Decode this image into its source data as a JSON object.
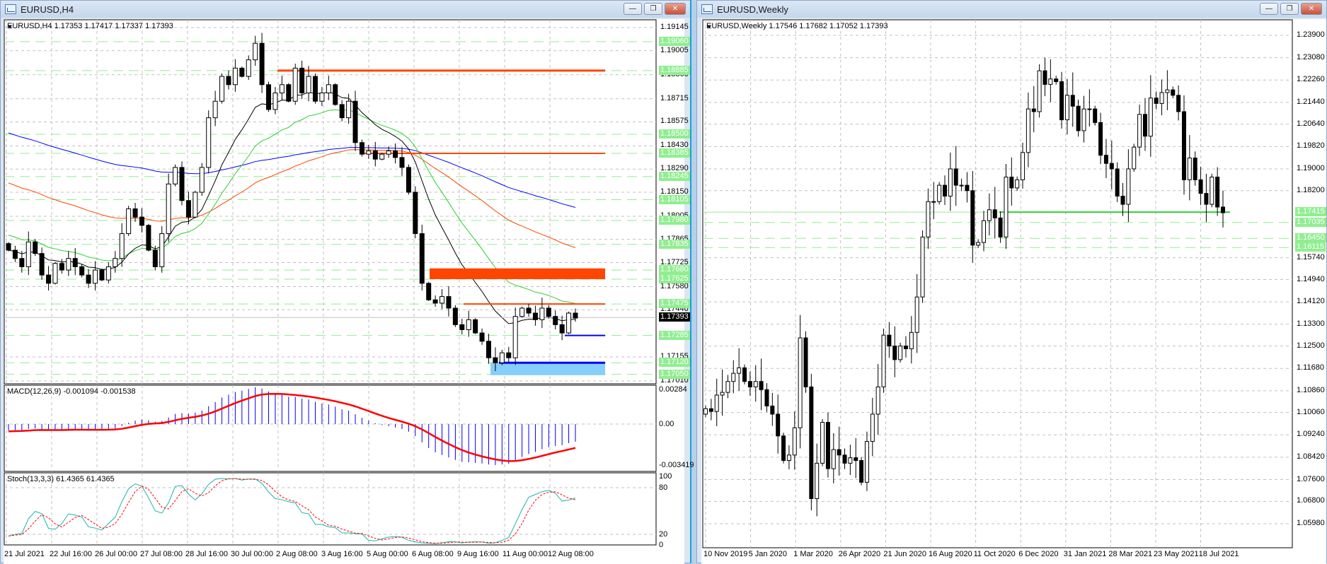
{
  "left_window": {
    "title": "EURUSD,H4",
    "info": "EURUSD,H4  1.17353 1.17417 1.17337 1.17393",
    "buttons": {
      "minimize": "—",
      "restore": "❐",
      "close": "✕"
    },
    "price_labels": [
      "1.19145",
      "1.19005",
      "1.18860",
      "1.18715",
      "1.18575",
      "1.18430",
      "1.18290",
      "1.18150",
      "1.18005",
      "1.17865",
      "1.17725",
      "1.17580",
      "1.17440",
      "1.17155",
      "1.17010"
    ],
    "level_labels": [
      "1.19060",
      "1.18885",
      "1.18500",
      "1.18385",
      "1.18245",
      "1.18105",
      "1.17980",
      "1.17835",
      "1.17680",
      "1.17625",
      "1.17475",
      "1.17285",
      "1.17120",
      "1.17050"
    ],
    "current_price": "1.17393",
    "time_labels": [
      "21 Jul 2021",
      "22 Jul 16:00",
      "26 Jul 00:00",
      "27 Jul 08:00",
      "28 Jul 16:00",
      "30 Jul 00:00",
      "2 Aug 08:00",
      "3 Aug 16:00",
      "5 Aug 00:00",
      "6 Aug 08:00",
      "9 Aug 16:00",
      "11 Aug 00:00",
      "12 Aug 08:00"
    ],
    "closes": [
      1.178,
      1.1775,
      1.177,
      1.1785,
      1.1778,
      1.1765,
      1.176,
      1.1772,
      1.1768,
      1.1775,
      1.177,
      1.1765,
      1.176,
      1.1768,
      1.1762,
      1.177,
      1.1775,
      1.179,
      1.1805,
      1.18,
      1.1795,
      1.178,
      1.177,
      1.179,
      1.182,
      1.183,
      1.181,
      1.18,
      1.1815,
      1.183,
      1.186,
      1.187,
      1.1885,
      1.188,
      1.189,
      1.1885,
      1.1895,
      1.1905,
      1.188,
      1.1865,
      1.1875,
      1.188,
      1.187,
      1.189,
      1.1875,
      1.1885,
      1.187,
      1.1875,
      1.188,
      1.1868,
      1.186,
      1.187,
      1.1845,
      1.1838,
      1.184,
      1.1835,
      1.1838,
      1.184,
      1.1836,
      1.183,
      1.1815,
      1.179,
      1.176,
      1.175,
      1.1748,
      1.1752,
      1.1745,
      1.1735,
      1.1732,
      1.1738,
      1.173,
      1.1725,
      1.1715,
      1.1712,
      1.1718,
      1.1715,
      1.174,
      1.1745,
      1.1742,
      1.1738,
      1.1745,
      1.174,
      1.1735,
      1.173,
      1.1742,
      1.1739
    ],
    "macd": {
      "label": "MACD(12,26,9) -0.001094 -0.001538",
      "scale": [
        "0.00284",
        "0.00",
        "-0.003419"
      ]
    },
    "stoch": {
      "label": "Stoch(13,3,3) 61.4365 61.4365",
      "scale": [
        "100",
        "80",
        "20",
        "0"
      ]
    },
    "colors": {
      "ma_long": "#0000ff",
      "ma_mid": "#ff4500",
      "ma_short": "#32cd32",
      "ma_fast": "#000000",
      "resistance": "#ff4500",
      "support": "#0000ff",
      "support_zone": "#87cefa",
      "level": "#90ee90"
    }
  },
  "right_window": {
    "title": "EURUSD,Weekly",
    "info": "EURUSD,Weekly  1.17546 1.17682 1.17052 1.17393",
    "buttons": {
      "minimize": "—",
      "restore": "❐",
      "close": "✕"
    },
    "price_labels": [
      "1.23900",
      "1.23080",
      "1.22260",
      "1.21440",
      "1.20640",
      "1.19820",
      "1.19000",
      "1.18200",
      "1.15740",
      "1.14940",
      "1.14120",
      "1.13300",
      "1.12500",
      "1.11680",
      "1.10860",
      "1.10060",
      "1.09240",
      "1.08420",
      "1.07600",
      "1.06800",
      "1.05980"
    ],
    "level_labels": [
      "1.17415",
      "1.17035",
      "1.16450",
      "1.16115"
    ],
    "time_labels": [
      "10 Nov 2019",
      "5 Jan 2020",
      "1 Mar 2020",
      "26 Apr 2020",
      "21 Jun 2020",
      "16 Aug 2020",
      "11 Oct 2020",
      "6 Dec 2020",
      "31 Jan 2021",
      "28 Mar 2021",
      "23 May 2021",
      "18 Jul 2021"
    ],
    "closes": [
      1.102,
      1.101,
      1.107,
      1.108,
      1.112,
      1.115,
      1.117,
      1.112,
      1.11,
      1.112,
      1.109,
      1.103,
      1.1,
      1.092,
      1.083,
      1.085,
      1.095,
      1.128,
      1.11,
      1.069,
      1.082,
      1.097,
      1.08,
      1.087,
      1.085,
      1.082,
      1.084,
      1.083,
      1.075,
      1.09,
      1.1,
      1.11,
      1.129,
      1.125,
      1.12,
      1.125,
      1.124,
      1.13,
      1.143,
      1.165,
      1.178,
      1.178,
      1.184,
      1.18,
      1.19,
      1.184,
      1.184,
      1.182,
      1.162,
      1.163,
      1.171,
      1.175,
      1.172,
      1.165,
      1.187,
      1.183,
      1.186,
      1.196,
      1.212,
      1.211,
      1.226,
      1.221,
      1.223,
      1.222,
      1.208,
      1.217,
      1.213,
      1.204,
      1.212,
      1.212,
      1.207,
      1.195,
      1.192,
      1.19,
      1.18,
      1.177,
      1.19,
      1.198,
      1.21,
      1.202,
      1.216,
      1.214,
      1.218,
      1.219,
      1.217,
      1.211,
      1.186,
      1.194,
      1.186,
      1.181,
      1.177,
      1.187,
      1.176,
      1.1739
    ],
    "colors": {
      "support": "#32cd32",
      "level": "#90ee90"
    }
  }
}
